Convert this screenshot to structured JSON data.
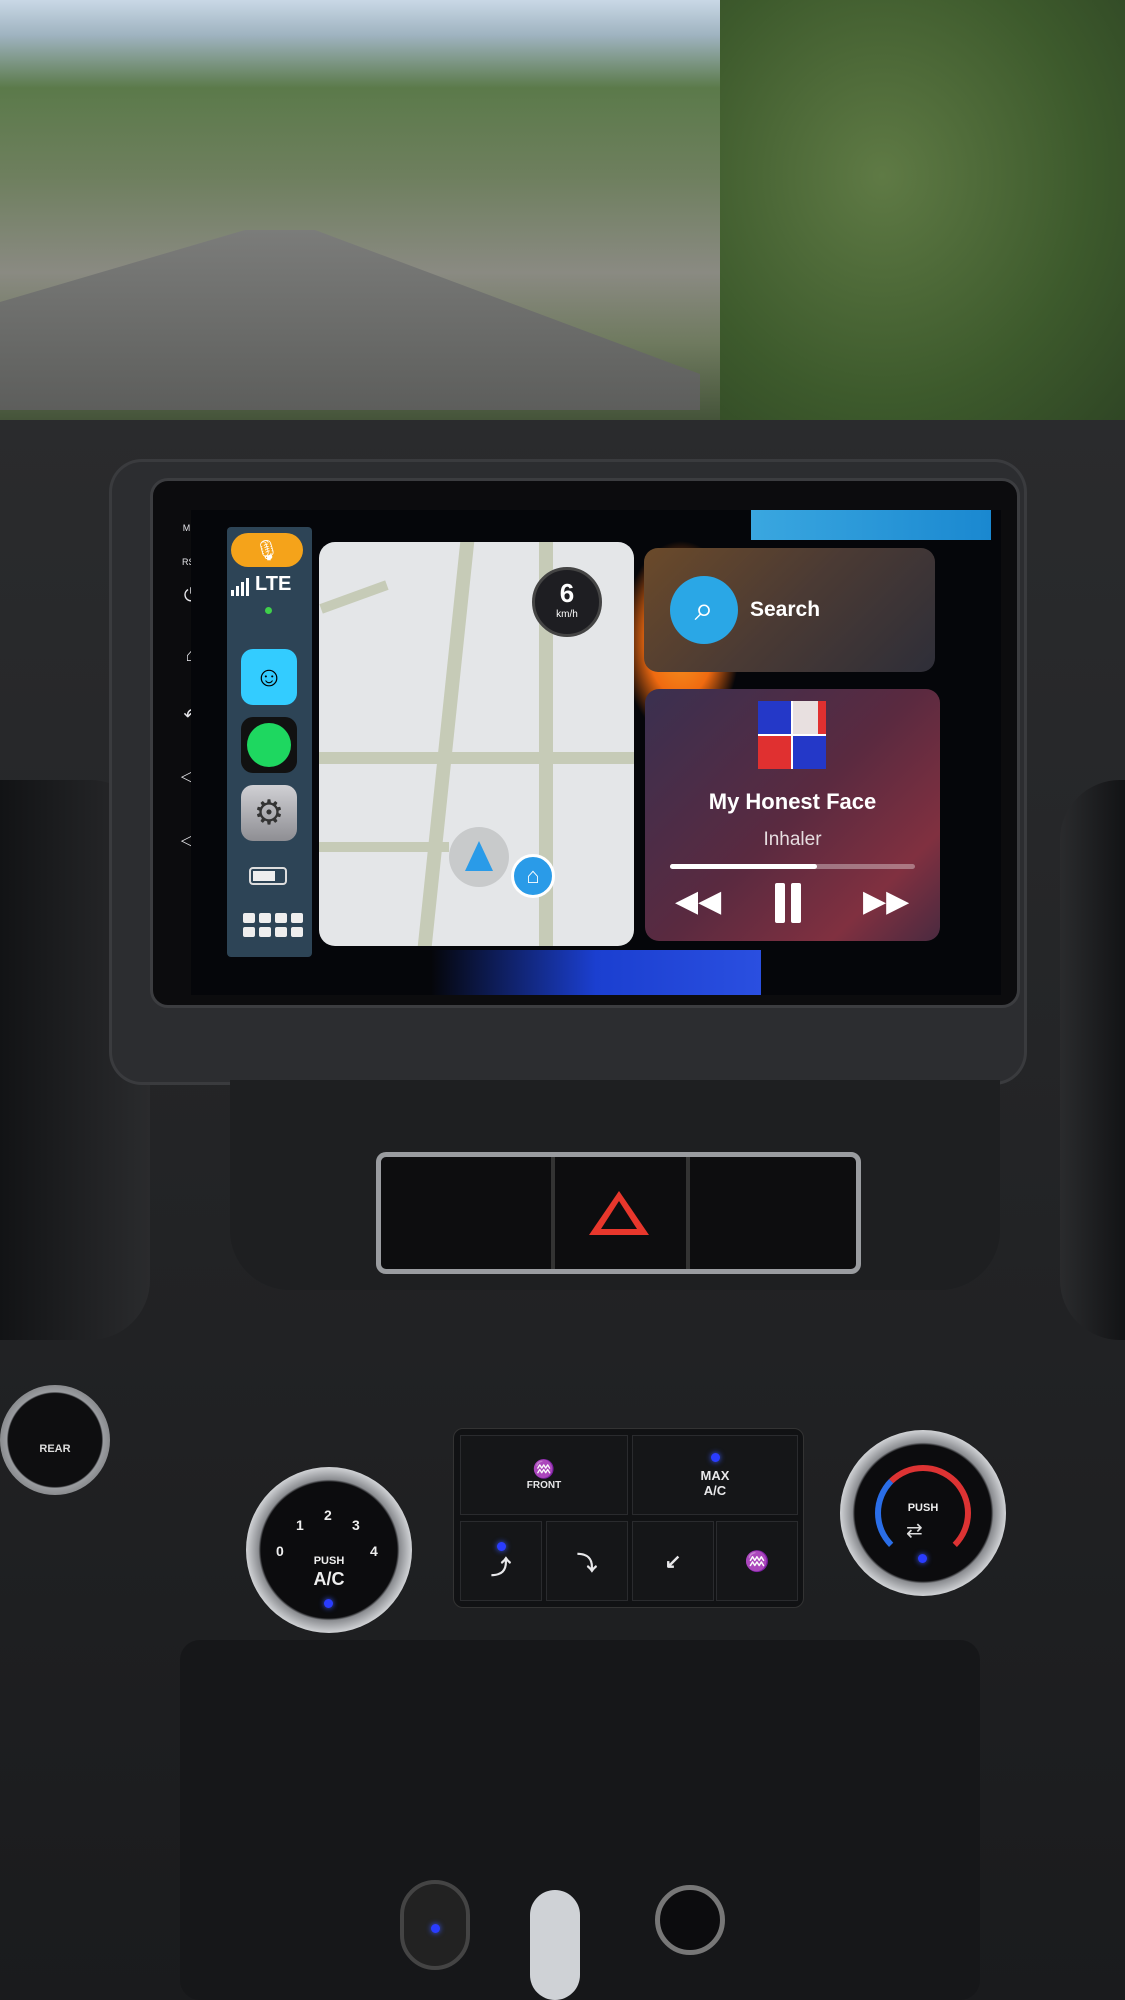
{
  "hardware_buttons": {
    "mic": "MIC",
    "rst": "RST",
    "icons": [
      "power-icon",
      "home-icon",
      "back-icon",
      "volume-up-icon",
      "volume-down-icon"
    ]
  },
  "status": {
    "signal": "LTE"
  },
  "dock": {
    "apps": [
      {
        "name": "Waze",
        "icon": "waze-icon",
        "color": "#33ccff"
      },
      {
        "name": "Spotify",
        "icon": "spotify-icon",
        "color": "#1ed760"
      },
      {
        "name": "Settings",
        "icon": "settings-icon",
        "color": "#8e8e93"
      }
    ],
    "siri_color": "#f5a31a"
  },
  "map": {
    "speed": "6",
    "speed_unit": "km/h"
  },
  "search": {
    "label": "Search",
    "accent": "#2aa7e6"
  },
  "now_playing": {
    "title": "My Honest Face",
    "artist": "Inhaler",
    "progress": 0.6
  },
  "climate": {
    "front": "FRONT",
    "max_ac_1": "MAX",
    "max_ac_2": "A/C",
    "rear": "REAR",
    "push": "PUSH",
    "ac": "A/C",
    "fan_levels": [
      "0",
      "1",
      "2",
      "3",
      "4"
    ]
  }
}
